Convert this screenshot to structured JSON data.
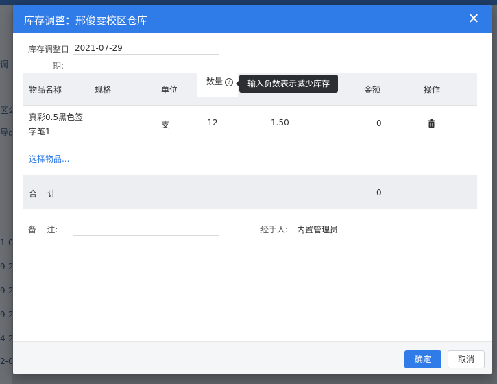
{
  "dialog": {
    "title": "库存调整：邢俊雯校区仓库",
    "close_label": "✕"
  },
  "form": {
    "date_label_line1": "库存调整日",
    "date_label_line2": "期:",
    "date_value": "2021-07-29",
    "remark_label": "备    注:",
    "remark_value": "",
    "handler_label": "经手人:",
    "handler_value": "内置管理员"
  },
  "table": {
    "headers": {
      "name": "物品名称",
      "spec": "规格",
      "unit": "单位",
      "qty": "数量",
      "amount": "金额",
      "action": "操作"
    },
    "qty_tooltip": "输入负数表示减少库存",
    "rows": [
      {
        "name_line1": "真彩0.5黑色签",
        "name_line2": "字笔1",
        "spec": "",
        "unit": "支",
        "qty": "-12",
        "price": "1.50",
        "amount": "0"
      }
    ],
    "select_items_link": "选择物品...",
    "total_label": "合    计",
    "total_amount": "0"
  },
  "footer": {
    "confirm_label": "确定",
    "cancel_label": "取消"
  },
  "background": {
    "left_fragments": [
      "调",
      "区么",
      "导出",
      "1-0",
      "9-2",
      "9-2",
      "9-2",
      "4-2",
      "2-0"
    ]
  },
  "colors": {
    "primary": "#2f7be8",
    "tooltip_bg": "#2b2f33"
  }
}
